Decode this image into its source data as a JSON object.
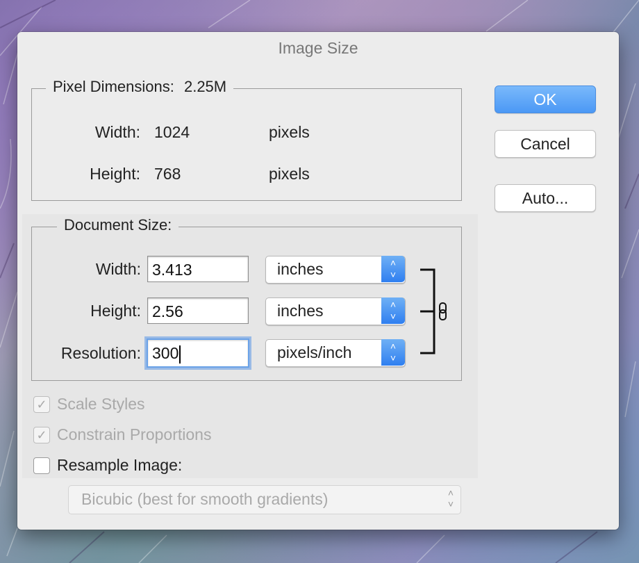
{
  "window": {
    "title": "Image Size"
  },
  "pixel_dimensions": {
    "label": "Pixel Dimensions:",
    "size": "2.25M",
    "width_label": "Width:",
    "width_value": "1024",
    "width_unit": "pixels",
    "height_label": "Height:",
    "height_value": "768",
    "height_unit": "pixels"
  },
  "document_size": {
    "label": "Document Size:",
    "width_label": "Width:",
    "width_value": "3.413",
    "width_unit": "inches",
    "height_label": "Height:",
    "height_value": "2.56",
    "height_unit": "inches",
    "resolution_label": "Resolution:",
    "resolution_value": "300",
    "resolution_unit": "pixels/inch"
  },
  "options": {
    "scale_styles": {
      "label": "Scale Styles",
      "checked": true,
      "enabled": false
    },
    "constrain_proportions": {
      "label": "Constrain Proportions",
      "checked": true,
      "enabled": false
    },
    "resample_image": {
      "label": "Resample Image:",
      "checked": false,
      "enabled": true
    },
    "resample_method": "Bicubic (best for smooth gradients)"
  },
  "buttons": {
    "ok": "OK",
    "cancel": "Cancel",
    "auto": "Auto..."
  },
  "icons": {
    "link": "chain-link-icon",
    "stepper": "up-down-chevron-icon",
    "check": "checkmark-icon"
  },
  "colors": {
    "accent": "#4b98f5",
    "dialog_bg": "#ececec"
  }
}
